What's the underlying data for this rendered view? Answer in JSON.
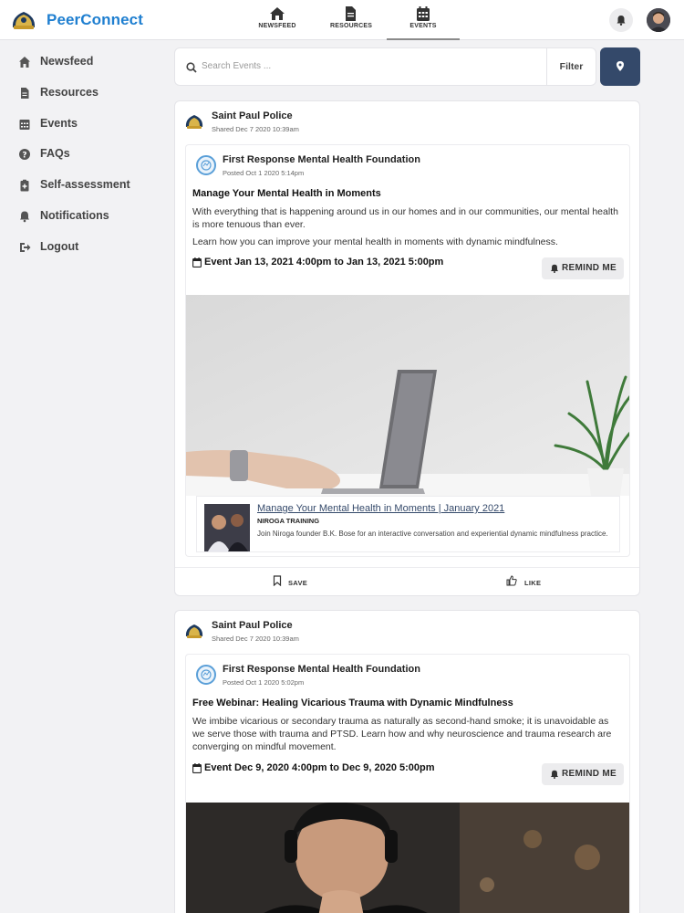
{
  "brand": {
    "name": "PeerConnect"
  },
  "nav": {
    "tabs": [
      {
        "label": "NEWSFEED",
        "icon": "home-icon"
      },
      {
        "label": "RESOURCES",
        "icon": "document-icon"
      },
      {
        "label": "EVENTS",
        "icon": "calendar-icon"
      }
    ],
    "active": "EVENTS"
  },
  "sidebar": {
    "items": [
      {
        "label": "Newsfeed",
        "icon": "home-icon"
      },
      {
        "label": "Resources",
        "icon": "document-icon"
      },
      {
        "label": "Events",
        "icon": "calendar-icon"
      },
      {
        "label": "FAQs",
        "icon": "question-icon"
      },
      {
        "label": "Self-assessment",
        "icon": "clipboard-icon"
      },
      {
        "label": "Notifications",
        "icon": "bell-icon"
      },
      {
        "label": "Logout",
        "icon": "logout-icon"
      }
    ]
  },
  "search": {
    "placeholder": "Search Events ...",
    "filter_label": "Filter"
  },
  "posts": [
    {
      "sharer": "Saint Paul Police",
      "shared": "Shared Dec 7 2020 10:39am",
      "org": "First Response Mental Health Foundation",
      "posted": "Posted Oct 1 2020 5:14pm",
      "title": "Manage Your Mental Health in Moments",
      "desc1": "With everything that is happening around us in our homes and in our communities, our mental health is more tenuous than ever.",
      "desc2": "Learn how you can improve your mental health in moments with dynamic mindfulness.",
      "event": "Event Jan 13, 2021 4:00pm to Jan 13, 2021 5:00pm",
      "remind": "REMIND ME",
      "link": {
        "title": "Manage Your Mental Health in Moments | January 2021",
        "source": "NIROGA TRAINING",
        "desc": "Join Niroga founder B.K. Bose for an interactive conversation and experiential dynamic mindfulness practice."
      },
      "save": "SAVE",
      "like": "LIKE"
    },
    {
      "sharer": "Saint Paul Police",
      "shared": "Shared Dec 7 2020 10:39am",
      "org": "First Response Mental Health Foundation",
      "posted": "Posted Oct 1 2020 5:02pm",
      "title": "Free Webinar: Healing Vicarious Trauma with Dynamic Mindfulness",
      "desc1": "We imbibe vicarious or secondary trauma as naturally as second-hand smoke; it is unavoidable as we serve those with trauma and PTSD. Learn how and why neuroscience and trauma research are converging on mindful movement.",
      "event": "Event Dec 9, 2020 4:00pm to Dec 9, 2020 5:00pm",
      "remind": "REMIND ME"
    }
  ]
}
